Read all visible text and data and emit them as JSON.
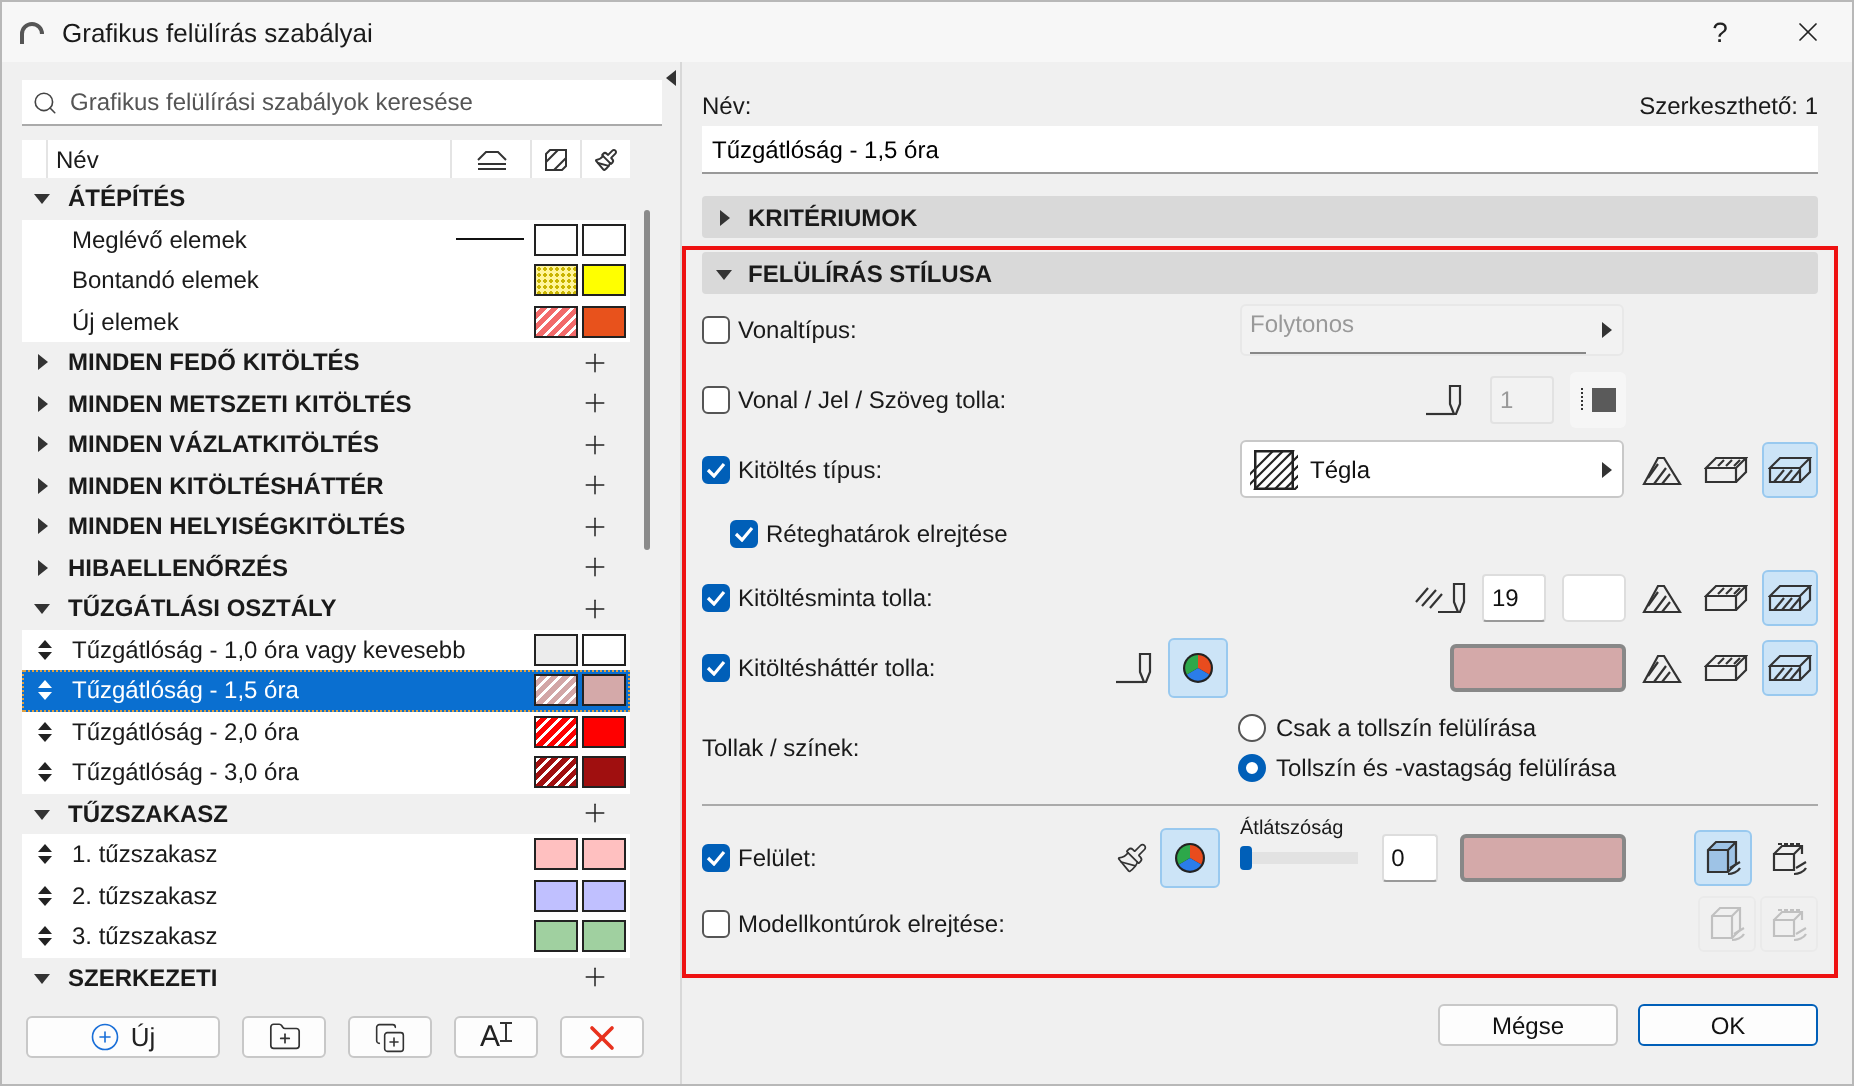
{
  "window": {
    "title": "Grafikus felülírás szabályai",
    "help": "?"
  },
  "search": {
    "placeholder": "Grafikus felülírási szabályok keresése"
  },
  "list_header": {
    "name": "Név"
  },
  "groups": [
    {
      "name": "ÁTÉPÍTÉS",
      "expanded": true,
      "addable": false,
      "items": [
        {
          "name": "Meglévő elemek",
          "draggable": false,
          "line": true,
          "fill": {
            "kind": "solid",
            "color": "#ffffff"
          },
          "color": "#ffffff",
          "selected": false
        },
        {
          "name": "Bontandó elemek",
          "draggable": false,
          "line": false,
          "fill": {
            "kind": "dots",
            "color": "#fff59a"
          },
          "color": "#ffff00",
          "selected": false
        },
        {
          "name": "Új elemek",
          "draggable": false,
          "line": false,
          "fill": {
            "kind": "hatch",
            "color": "#f26a6a"
          },
          "color": "#e8521c",
          "selected": false
        }
      ]
    },
    {
      "name": "MINDEN FEDŐ KITÖLTÉS",
      "expanded": false,
      "addable": true
    },
    {
      "name": "MINDEN METSZETI KITÖLTÉS",
      "expanded": false,
      "addable": true
    },
    {
      "name": "MINDEN VÁZLATKITÖLTÉS",
      "expanded": false,
      "addable": true
    },
    {
      "name": "MINDEN KITÖLTÉSHÁTTÉR",
      "expanded": false,
      "addable": true
    },
    {
      "name": "MINDEN HELYISÉGKITÖLTÉS",
      "expanded": false,
      "addable": true
    },
    {
      "name": "HIBAELLENŐRZÉS",
      "expanded": false,
      "addable": true
    },
    {
      "name": "TŰZGÁTLÁSI OSZTÁLY",
      "expanded": true,
      "addable": true,
      "items": [
        {
          "name": "Tűzgátlóság - 1,0 óra vagy kevesebb",
          "draggable": true,
          "line": false,
          "fill": {
            "kind": "solid",
            "color": "#ececec"
          },
          "color": "#ffffff",
          "selected": false
        },
        {
          "name": "Tűzgátlóság - 1,5 óra",
          "draggable": true,
          "line": false,
          "fill": {
            "kind": "hatch",
            "color": "#d2a6a6"
          },
          "color": "#d4a9a9",
          "selected": true
        },
        {
          "name": "Tűzgátlóság - 2,0 óra",
          "draggable": true,
          "line": false,
          "fill": {
            "kind": "hatch",
            "color": "#ff0000"
          },
          "color": "#ff0000",
          "selected": false
        },
        {
          "name": "Tűzgátlóság - 3,0 óra",
          "draggable": true,
          "line": false,
          "fill": {
            "kind": "hatch",
            "color": "#a00f0f"
          },
          "color": "#a00f0f",
          "selected": false
        }
      ]
    },
    {
      "name": "TŰZSZAKASZ",
      "expanded": true,
      "addable": true,
      "items": [
        {
          "name": "1. tűzszakasz",
          "draggable": true,
          "line": false,
          "fill": {
            "kind": "solid",
            "color": "#ffc0c0"
          },
          "color": "#ffc0c0",
          "selected": false
        },
        {
          "name": "2. tűzszakasz",
          "draggable": true,
          "line": false,
          "fill": {
            "kind": "solid",
            "color": "#c0c0ff"
          },
          "color": "#c0c0ff",
          "selected": false
        },
        {
          "name": "3. tűzszakasz",
          "draggable": true,
          "line": false,
          "fill": {
            "kind": "solid",
            "color": "#a0d0a0"
          },
          "color": "#a0d0a0",
          "selected": false
        }
      ]
    },
    {
      "name": "SZERKEZETI",
      "expanded": true,
      "addable": true
    }
  ],
  "list_buttons": [
    {
      "kind": "new",
      "label": "Új"
    },
    {
      "kind": "new_folder"
    },
    {
      "kind": "duplicate"
    },
    {
      "kind": "rename",
      "glyph": "A"
    },
    {
      "kind": "delete"
    }
  ],
  "name_label": "Név:",
  "editable": "Szerkeszthető: 1",
  "name_value": "Tűzgátlóság - 1,5 óra",
  "sections": [
    {
      "title": "KRITÉRIUMOK",
      "expanded": false,
      "highlighted": false
    },
    {
      "title": "FELÜLÍRÁS STÍLUSA",
      "expanded": true,
      "highlighted": true
    }
  ],
  "style_rows": [
    {
      "kind": "dropdown",
      "label": "Vonaltípus:",
      "checked": false,
      "value": "Folytonos"
    },
    {
      "kind": "pen",
      "label": "Vonal / Jel / Szöveg tolla:",
      "checked": false,
      "pen": "1"
    },
    {
      "kind": "fill",
      "label": "Kitöltés típus:",
      "checked": true,
      "value": "Tégla",
      "modes": [
        {
          "selected": false
        },
        {
          "selected": false
        },
        {
          "selected": true
        }
      ]
    },
    {
      "kind": "sub",
      "label": "Réteghatárok elrejtése",
      "checked": true
    },
    {
      "kind": "fill_pen",
      "label": "Kitöltésminta tolla:",
      "checked": true,
      "pen": "19",
      "modes": [
        {
          "selected": false
        },
        {
          "selected": false
        },
        {
          "selected": true
        }
      ]
    },
    {
      "kind": "bg_pen",
      "label": "Kitöltésháttér tolla:",
      "checked": true,
      "wheel_on": true,
      "color": "#d4a9a9",
      "modes": [
        {
          "selected": false
        },
        {
          "selected": false
        },
        {
          "selected": true
        }
      ]
    },
    {
      "kind": "radio",
      "label": "Tollak / színek:",
      "options": [
        {
          "label": "Csak a tollszín felülírása",
          "selected": false
        },
        {
          "label": "Tollszín és -vastagság felülírása",
          "selected": true
        }
      ]
    },
    {
      "kind": "divider"
    },
    {
      "kind": "surface",
      "label": "Felület:",
      "checked": true,
      "wheel_on": true,
      "slider_label": "Átlátszóság",
      "level": 0,
      "value": "0",
      "color": "#d4a9a9",
      "modes": [
        {
          "selected": true
        },
        {
          "selected": false
        }
      ]
    },
    {
      "kind": "contours",
      "label": "Modellkontúrok elrejtése:",
      "checked": false,
      "modes": [
        {
          "selected": false
        },
        {
          "selected": false
        }
      ]
    }
  ],
  "footer_buttons": [
    {
      "label": "Mégse",
      "default": false
    },
    {
      "label": "OK",
      "default": true
    }
  ]
}
